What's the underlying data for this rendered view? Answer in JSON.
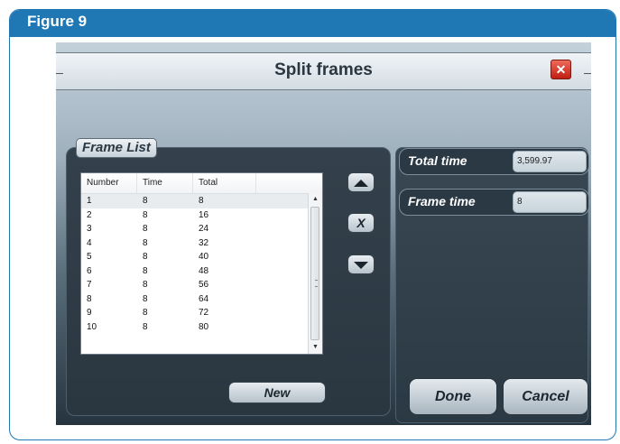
{
  "figure": {
    "title": "Figure 9"
  },
  "dialog": {
    "title": "Split frames",
    "close_label": "✕"
  },
  "frame_list": {
    "label": "Frame List",
    "columns": [
      "Number",
      "Time",
      "Total"
    ],
    "rows": [
      {
        "number": "1",
        "time": "8",
        "total": "8"
      },
      {
        "number": "2",
        "time": "8",
        "total": "16"
      },
      {
        "number": "3",
        "time": "8",
        "total": "24"
      },
      {
        "number": "4",
        "time": "8",
        "total": "32"
      },
      {
        "number": "5",
        "time": "8",
        "total": "40"
      },
      {
        "number": "6",
        "time": "8",
        "total": "48"
      },
      {
        "number": "7",
        "time": "8",
        "total": "56"
      },
      {
        "number": "8",
        "time": "8",
        "total": "64"
      },
      {
        "number": "9",
        "time": "8",
        "total": "72"
      },
      {
        "number": "10",
        "time": "8",
        "total": "80"
      }
    ],
    "selected_row": 0,
    "scroll_up_glyph": "▲",
    "scroll_down_glyph": "▼"
  },
  "side_buttons": {
    "up_icon": "triangle-up-icon",
    "delete_label": "X",
    "down_icon": "triangle-down-icon"
  },
  "new_button": {
    "label": "New"
  },
  "fields": {
    "total_time": {
      "label": "Total time",
      "value": "3,599.97"
    },
    "frame_time": {
      "label": "Frame time",
      "value": "8"
    }
  },
  "actions": {
    "done_label": "Done",
    "cancel_label": "Cancel"
  },
  "colors": {
    "figure_accent": "#1f78b4",
    "close_button": "#d9352a"
  }
}
